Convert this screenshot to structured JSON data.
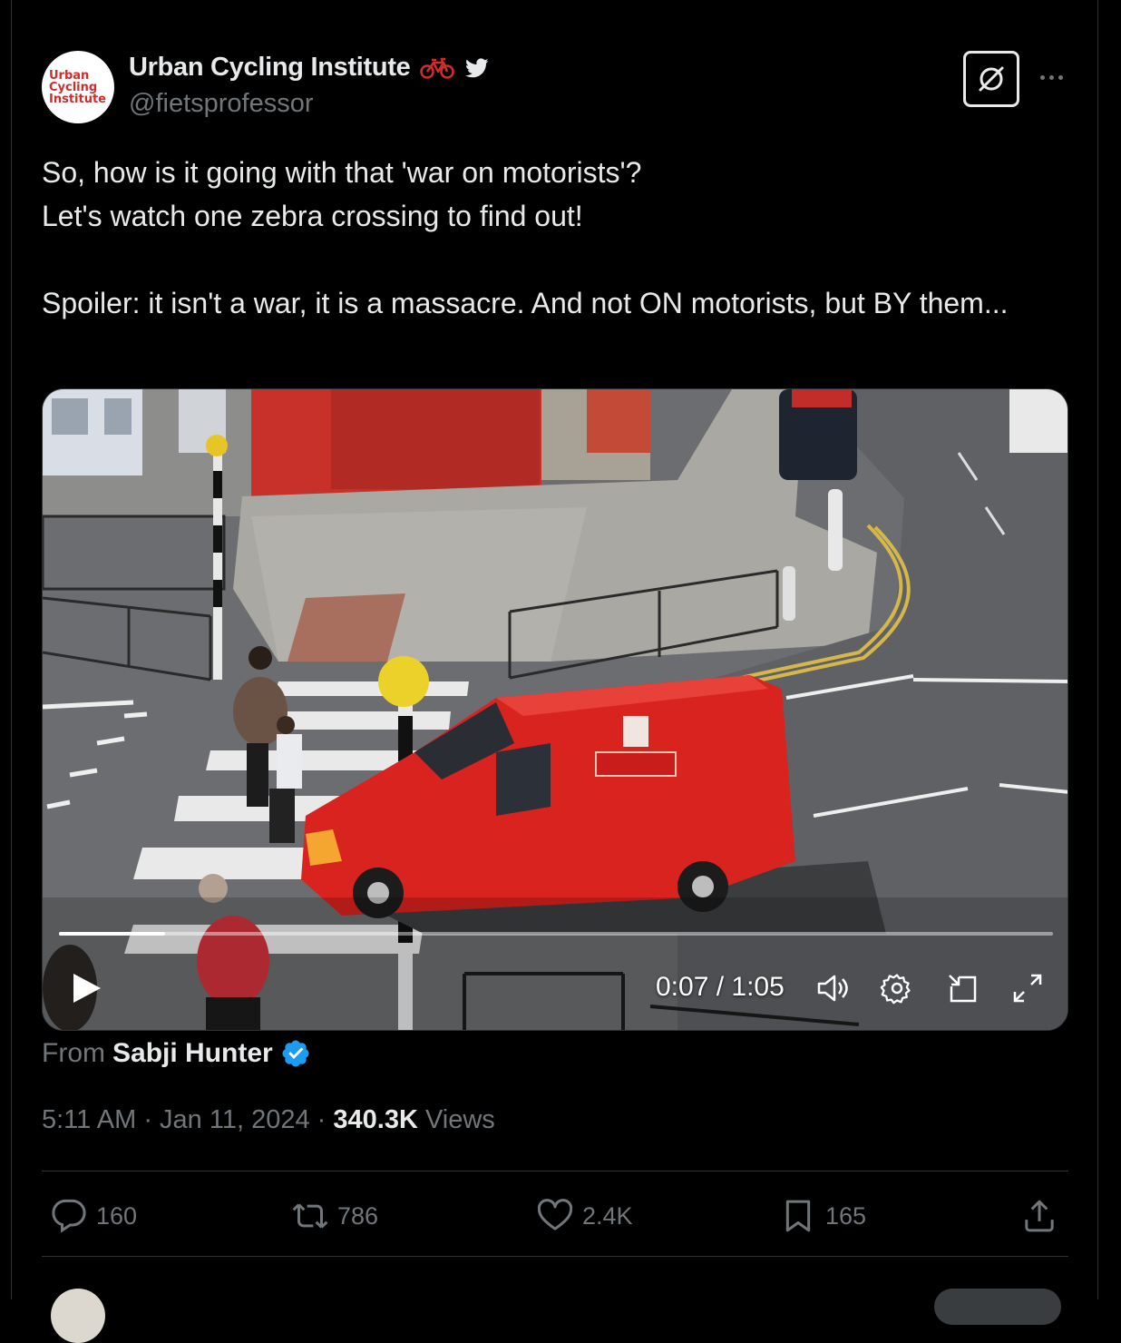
{
  "author": {
    "avatar_text": [
      "Urban",
      "Cycling",
      "Institute"
    ],
    "display_name": "Urban Cycling Institute",
    "handle": "@fietsprofessor",
    "badge_icons": [
      "bicycle-icon",
      "twitter-bird-icon"
    ]
  },
  "header_actions": {
    "grok_icon": "grok-icon",
    "more_icon": "more-options-icon"
  },
  "tweet": {
    "lines": [
      "So, how is it going with that 'war on motorists'?",
      "Let's watch one zebra crossing to find out!",
      "Spoiler: it isn't a war, it is a massacre. And not ON motorists, but BY them..."
    ]
  },
  "video": {
    "progress_fraction": 0.107,
    "time_display": "0:07 / 1:05",
    "controls": [
      "play-icon",
      "volume-icon",
      "settings-icon",
      "pip-icon",
      "fullscreen-icon"
    ]
  },
  "source": {
    "from_label": "From",
    "name": "Sabji Hunter",
    "verified_icon": "verified-badge-icon"
  },
  "meta": {
    "time": "5:11 AM",
    "date": "Jan 11, 2024",
    "separator": "·",
    "views_count": "340.3K",
    "views_label": "Views"
  },
  "actions": {
    "replies": "160",
    "reposts": "786",
    "likes": "2.4K",
    "bookmarks": "165"
  },
  "colors": {
    "background": "#000000",
    "text": "#e7e9ea",
    "muted": "#71767b",
    "divider": "#2f3336",
    "verified": "#1d9bf0",
    "van_red": "#d8231f"
  }
}
